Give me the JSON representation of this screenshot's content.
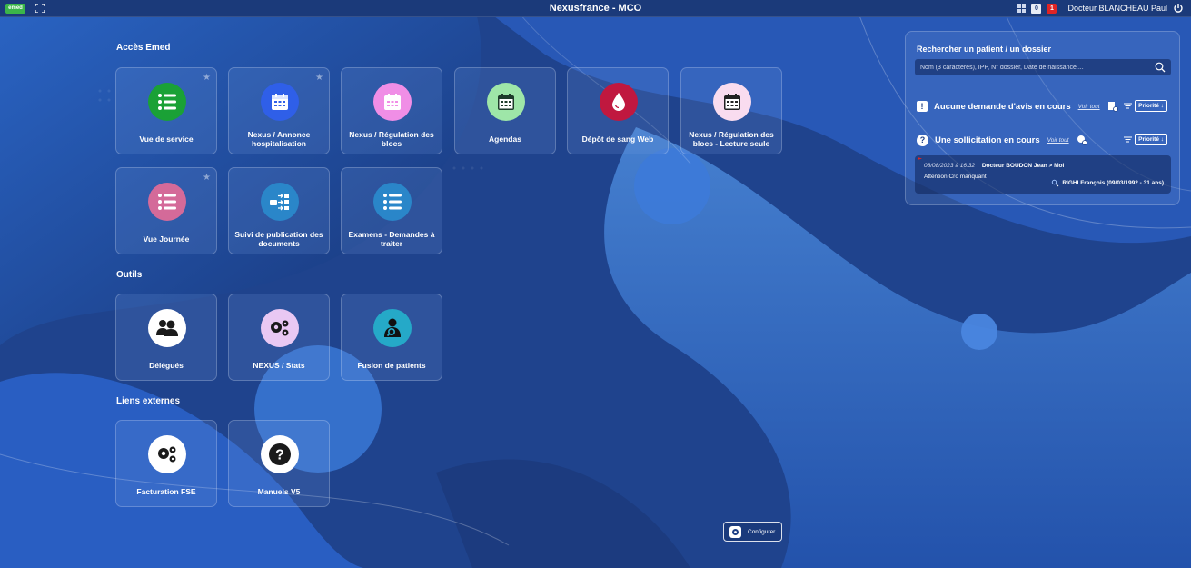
{
  "app": {
    "title": "Nexusfrance - MCO",
    "logo_text": "emed",
    "user_name": "Docteur BLANCHEAU Paul",
    "badge_doc": "0",
    "badge_alert": "1"
  },
  "sections": {
    "acces": "Accès Emed",
    "outils": "Outils",
    "liens": "Liens externes"
  },
  "tiles": [
    {
      "label": "Vue de service",
      "icon": "list-people-icon",
      "color": "#1aa136",
      "star": true
    },
    {
      "label": "Nexus / Annonce hospitalisation",
      "icon": "calendar-icon",
      "color": "#2f5fe8",
      "star": true
    },
    {
      "label": "Nexus / Régulation des blocs",
      "icon": "calendar-icon",
      "color": "#f08ee6",
      "star": false
    },
    {
      "label": "Agendas",
      "icon": "calendar-icon",
      "color": "#9ee6a8",
      "star": false
    },
    {
      "label": "Dépôt de sang Web",
      "icon": "blood-drop-icon",
      "color": "#c0183f",
      "star": false
    },
    {
      "label": "Nexus / Régulation des blocs - Lecture seule",
      "icon": "calendar-icon",
      "color": "#f9dcef",
      "star": false
    },
    {
      "label": "Vue Journée",
      "icon": "list-people-icon",
      "color": "#d46a99",
      "star": true
    },
    {
      "label": "Suivi de publication des documents",
      "icon": "document-flow-icon",
      "color": "#2a86c9",
      "star": false
    },
    {
      "label": "Examens - Demandes à traiter",
      "icon": "list-people-icon",
      "color": "#2a86c9",
      "star": false
    },
    {
      "label": "Délégués",
      "icon": "users-icon",
      "color": "#ffffff",
      "star": false
    },
    {
      "label": "NEXUS / Stats",
      "icon": "gears-icon",
      "color": "#e9c8f3",
      "star": false
    },
    {
      "label": "Fusion de patients",
      "icon": "patient-search-icon",
      "color": "#25a9c8",
      "star": false
    },
    {
      "label": "Facturation FSE",
      "icon": "gears-icon",
      "color": "#ffffff",
      "star": false
    },
    {
      "label": "Manuels V5",
      "icon": "question-icon",
      "color": "#ffffff",
      "star": false
    }
  ],
  "panel": {
    "title": "Rechercher un patient / un dossier",
    "search_placeholder": "Nom (3 caractères), IPP, N° dossier, Date de naissance....",
    "avis_text": "Aucune demande d'avis en cours",
    "sollic_text": "Une sollicitation en cours",
    "voir_tout": "Voir tout",
    "priorite": "Priorité",
    "sollicitation": {
      "date": "08/08/2023 à 16:32",
      "from_to": "Docteur BOUDON Jean > Moi",
      "message": "Attention Cro manquant",
      "patient": "RIGHI François (09/03/1992 - 31 ans)"
    }
  },
  "configure_label": "Configurer"
}
